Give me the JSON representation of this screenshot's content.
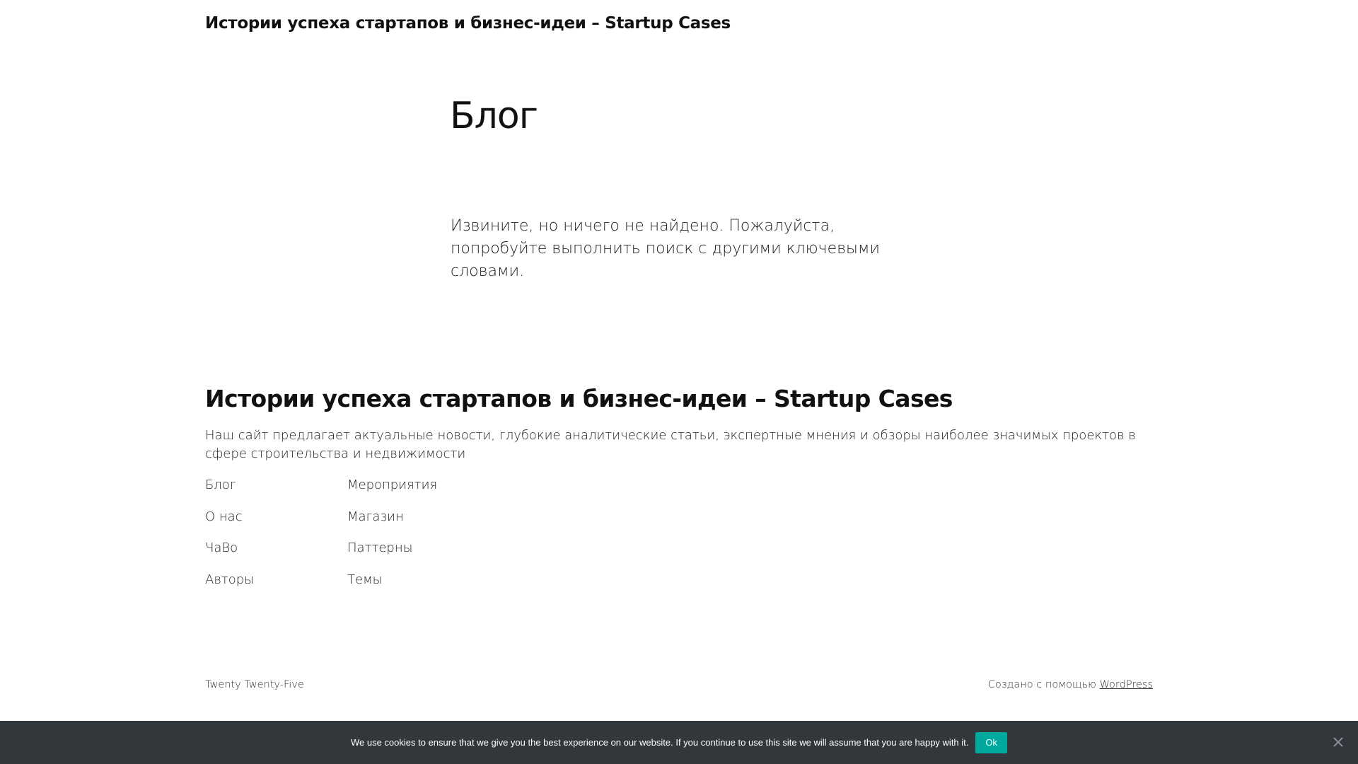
{
  "header": {
    "site_title": "Истории успеха стартапов и бизнес-идеи – Startup Cases"
  },
  "main": {
    "title": "Блог",
    "not_found_text": "Извините, но ничего не найдено. Пожалуйста, попробуйте выполнить поиск с другими ключевыми словами."
  },
  "footer": {
    "site_title": "Истории успеха стартапов и бизнес-идеи – Startup Cases",
    "description": "Наш сайт предлагает актуальные новости, глубокие аналитические статьи, экспертные мнения и обзоры наиболее значимых проектов в сфере строительства и недвижимости",
    "nav_col1": [
      "Блог",
      "О нас",
      "ЧаВо",
      "Авторы"
    ],
    "nav_col2": [
      "Мероприятия",
      "Магазин",
      "Паттерны",
      "Темы"
    ],
    "theme_name": "Twenty Twenty-Five",
    "powered_prefix": "Создано с помощью ",
    "powered_link": "WordPress"
  },
  "cookie": {
    "text": "We use cookies to ensure that we give you the best experience on our website. If you continue to use this site we will assume that you are happy with it.",
    "ok_label": "Ok",
    "bg_color": "#32373c",
    "button_color": "#00a99d"
  },
  "icons": {
    "close": "close-icon"
  }
}
